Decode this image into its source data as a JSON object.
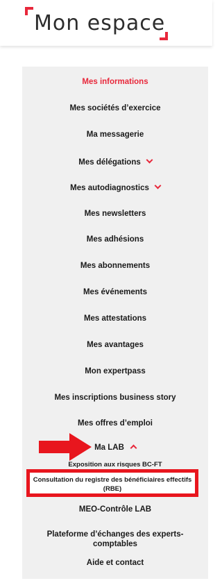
{
  "header": {
    "title": "Mon espace"
  },
  "menu": {
    "items": [
      {
        "label": "Mes informations"
      },
      {
        "label": "Mes sociétés d’exercice"
      },
      {
        "label": "Ma messagerie"
      },
      {
        "label": "Mes délégations"
      },
      {
        "label": "Mes autodiagnostics"
      },
      {
        "label": "Mes newsletters"
      },
      {
        "label": "Mes adhésions"
      },
      {
        "label": "Mes abonnements"
      },
      {
        "label": "Mes événements"
      },
      {
        "label": "Mes attestations"
      },
      {
        "label": "Mes avantages"
      },
      {
        "label": "Mon expertpass"
      },
      {
        "label": "Mes inscriptions business story"
      },
      {
        "label": "Mes offres d’emploi"
      },
      {
        "label": "Ma LAB"
      },
      {
        "label": "MEO-Contrôle LAB"
      },
      {
        "label": "Plateforme d’échanges des experts-comptables"
      },
      {
        "label": "Aide et contact"
      }
    ],
    "lab_submenu": [
      {
        "label": "Exposition aux risques BC-FT"
      },
      {
        "label": "Consultation du registre des bénéficiaires effectifs (RBE)"
      }
    ]
  },
  "colors": {
    "accent": "#e8283b",
    "highlight": "#e8161e",
    "panel_bg": "#f0f0f0"
  },
  "icons": [
    "chevron-down-icon",
    "chevron-up-icon",
    "arrow-right-icon"
  ]
}
